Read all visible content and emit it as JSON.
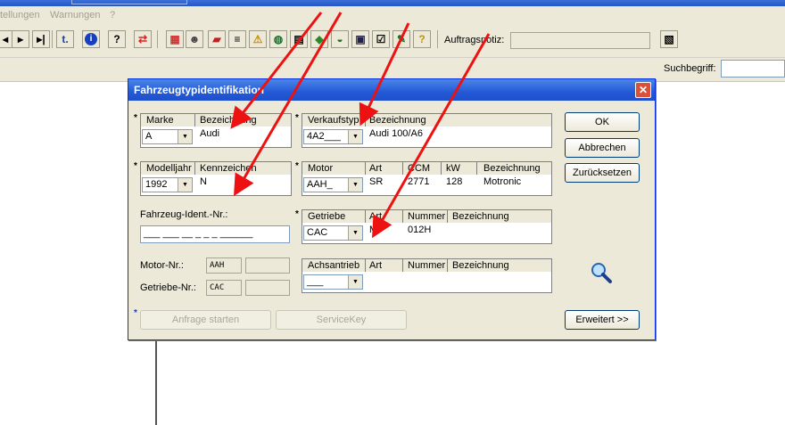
{
  "menubar": {
    "items": [
      "tellungen",
      "Warnungen",
      "?"
    ]
  },
  "toolbar": {
    "icons": [
      "first-icon",
      "prev-icon",
      "next-icon",
      "last-icon",
      "t1-icon",
      "info-icon",
      "help-icon",
      "swap-icon",
      "component-icon",
      "person-icon",
      "book-icon",
      "list-icon",
      "warning-icon",
      "globe-icon",
      "printer-icon",
      "plane-icon",
      "car-icon",
      "truck-icon",
      "checklist-icon",
      "tool-icon",
      "note-icon"
    ],
    "auftrag_label": "Auftragsnotiz:",
    "auftrag_value": ""
  },
  "search": {
    "label": "Suchbegriff:",
    "value": ""
  },
  "dialog": {
    "title": "Fahrzeugtypidentifikation",
    "close": "✕",
    "marke": {
      "headers": [
        "Marke",
        "Bezeichnung"
      ],
      "combo_value": "A",
      "bezeichnung": "Audi"
    },
    "modelljahr": {
      "headers": [
        "Modelljahr",
        "Kennzeichen"
      ],
      "combo_value": "1992",
      "kennzeichen": "N"
    },
    "vin": {
      "label": "Fahrzeug-Ident.-Nr.:",
      "value": "___ ___ __ _ _ _ ______"
    },
    "motornr": {
      "label": "Motor-Nr.:",
      "code": "AAH"
    },
    "getriebenr": {
      "label": "Getriebe-Nr.:",
      "code": "CAC"
    },
    "verkaufstyp": {
      "headers": [
        "Verkaufstyp",
        "Bezeichnung"
      ],
      "combo_value": "4A2___",
      "bezeichnung": "Audi 100/A6"
    },
    "motor": {
      "headers": [
        "Motor",
        "Art",
        "CCM",
        "kW",
        "Bezeichnung"
      ],
      "combo_value": "AAH_",
      "art": "SR",
      "ccm": "2771",
      "kw": "128",
      "bezeichnung": "Motronic"
    },
    "getriebe": {
      "headers": [
        "Getriebe",
        "Art",
        "Nummer",
        "Bezeichnung"
      ],
      "combo_value": "CAC",
      "art": "M",
      "nummer": "012H",
      "bezeichnung": ""
    },
    "achsantrieb": {
      "headers": [
        "Achsantrieb",
        "Art",
        "Nummer",
        "Bezeichnung"
      ],
      "combo_value": "___"
    },
    "buttons": {
      "ok": "OK",
      "abbrechen": "Abbrechen",
      "zuruecksetzen": "Zurücksetzen",
      "erweitert": "Erweitert >>",
      "anfrage": "Anfrage starten",
      "servicekey": "ServiceKey"
    },
    "star": "*"
  },
  "colors": {
    "dialog_title": "#2459d6",
    "annotation_arrow": "#ee1111",
    "window_bg": "#ece9d8"
  }
}
